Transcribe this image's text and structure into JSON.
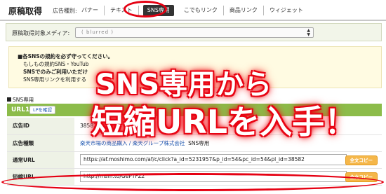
{
  "header": {
    "title": "原稿取得",
    "type_label": "広告種別:",
    "tabs": [
      {
        "label": "バナー"
      },
      {
        "label": "テキスト"
      },
      {
        "label": "SNS専用"
      },
      {
        "label": "こでもリンク"
      },
      {
        "label": "商品リンク"
      },
      {
        "label": "ウィジェット"
      }
    ],
    "active_tab": "SNS専用"
  },
  "media": {
    "label": "原稿取得対象メディア:",
    "selected_value": "( blurred )"
  },
  "notice": {
    "lines": [
      "■各SNSの規約を必ず守ってください。",
      "もしもの規約SNS・YouTub",
      "SNSでのみご利用いただけ",
      "SNS専用リンクを利用する"
    ]
  },
  "sns_section": {
    "label": "SNS専用",
    "url_bar_title": "URL1",
    "lp_button": "LPを確認",
    "rows": [
      {
        "label": "広告ID",
        "value": "38582"
      },
      {
        "label": "広告種類",
        "value_link": "楽天市場の商品購入 / 楽天グループ株式会社",
        "value_suffix": "SNS専用"
      },
      {
        "label": "通常URL",
        "value": "https://af.moshimo.com/af/c/click?a_id=5231957&p_id=54&pc_id=54&pl_id=38582",
        "copy": "全文コピー"
      },
      {
        "label": "短縮URL",
        "value": "http://msm.to/GePTFZz",
        "copy": "全文コピー"
      }
    ]
  },
  "overlay": {
    "line1": "SNS専用から",
    "line2": "短縮URLを入手！"
  },
  "colors": {
    "annotation_red": "#e50012",
    "url_bar_green": "#8cbc4a",
    "copy_orange": "#f5b74a"
  }
}
